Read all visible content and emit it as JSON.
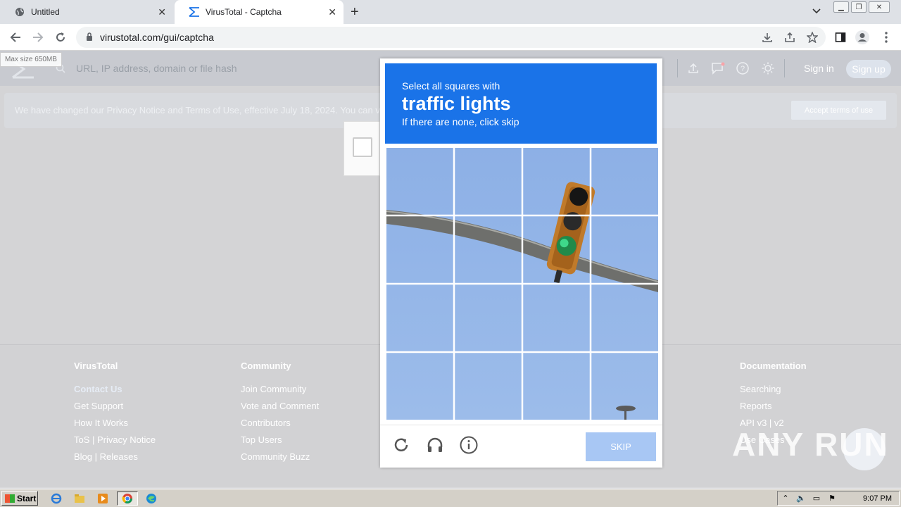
{
  "browser": {
    "tabs": [
      {
        "title": "Untitled",
        "active": false
      },
      {
        "title": "VirusTotal - Captcha",
        "active": true
      }
    ],
    "url": "virustotal.com/gui/captcha"
  },
  "page": {
    "max_size_label": "Max size 650MB",
    "search_placeholder": "URL, IP address, domain or file hash",
    "sign_in": "Sign in",
    "sign_up": "Sign up",
    "notice": "We have changed our Privacy Notice and Terms of Use, effective July 18, 2024. You can v",
    "accept_terms": "Accept terms of use",
    "footer": {
      "virustotal": {
        "title": "VirusTotal",
        "links": [
          "Contact Us",
          "Get Support",
          "How It Works",
          "ToS | Privacy Notice",
          "Blog | Releases"
        ]
      },
      "community": {
        "title": "Community",
        "links": [
          "Join Community",
          "Vote and Comment",
          "Contributors",
          "Top Users",
          "Community Buzz"
        ]
      },
      "documentation": {
        "title": "Documentation",
        "links": [
          "Searching",
          "Reports",
          "API v3 | v2",
          "Use Cases"
        ]
      }
    },
    "watermark": "ANY RUN"
  },
  "captcha": {
    "line1": "Select all squares with",
    "target": "traffic lights",
    "line3": "If there are none, click skip",
    "skip_label": "SKIP",
    "header_color": "#1a73e8",
    "icons": [
      "reload-icon",
      "audio-icon",
      "info-icon"
    ]
  },
  "taskbar": {
    "start_label": "Start",
    "clock": "9:07 PM"
  }
}
